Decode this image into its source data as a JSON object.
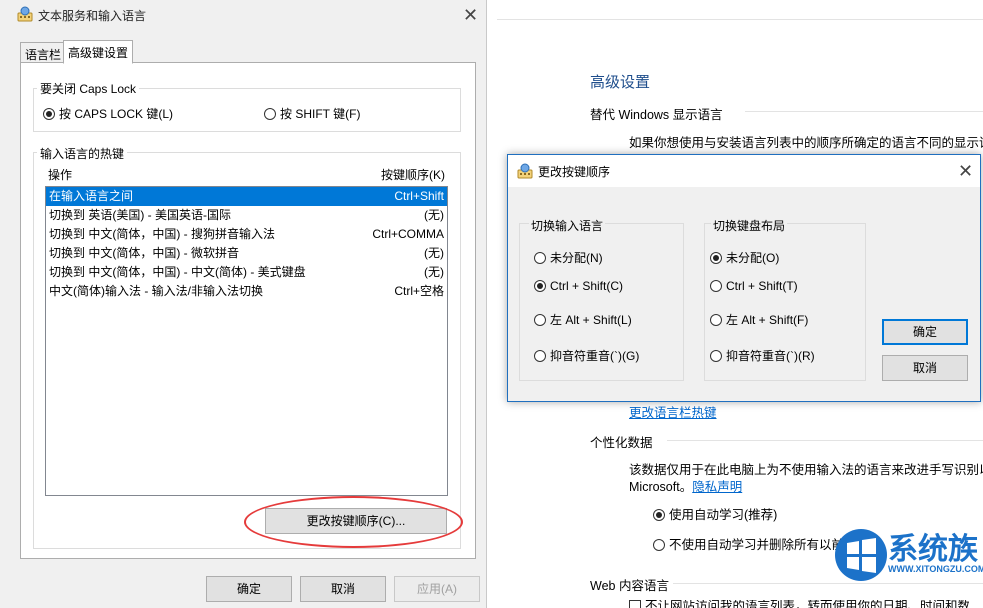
{
  "background": {
    "section_title": "高级设置",
    "override_label": "替代 Windows 显示语言",
    "override_desc": "如果你想使用与安装语言列表中的顺序所确定的语言不同的显示语",
    "langbar_link": "更改语言栏热键",
    "personal_title": "个性化数据",
    "personal_desc1": "该数据仅用于在此电脑上为不使用输入法的语言来改进手写识别以及",
    "personal_desc2_prefix": "Microsoft。",
    "privacy_link": "隐私声明",
    "auto_learn_on": "使用自动学习(推荐)",
    "auto_learn_off": "不使用自动学习并删除所有以前收集的数据",
    "web_title": "Web 内容语言",
    "web_desc": "不让网站访问我的语言列表，转而使用你的日期、时间和数字格"
  },
  "dialog1": {
    "title": "文本服务和输入语言",
    "tabs": [
      "语言栏",
      "高级键设置"
    ],
    "capslock": {
      "legend": "要关闭 Caps Lock",
      "option1": "按 CAPS LOCK 键(L)",
      "option2": "按 SHIFT 键(F)"
    },
    "hotkeys": {
      "legend": "输入语言的热键",
      "col_action": "操作",
      "col_sequence": "按键顺序(K)",
      "rows": [
        {
          "action": "在输入语言之间",
          "key": "Ctrl+Shift"
        },
        {
          "action": "切换到 英语(美国) - 美国英语-国际",
          "key": "(无)"
        },
        {
          "action": "切换到 中文(简体，中国) - 搜狗拼音输入法",
          "key": "Ctrl+COMMA"
        },
        {
          "action": "切换到 中文(简体，中国) - 微软拼音",
          "key": "(无)"
        },
        {
          "action": "切换到 中文(简体，中国) - 中文(简体) - 美式键盘",
          "key": "(无)"
        },
        {
          "action": "中文(简体)输入法 - 输入法/非输入法切换",
          "key": "Ctrl+空格"
        }
      ],
      "change_button": "更改按键顺序(C)..."
    },
    "buttons": {
      "ok": "确定",
      "cancel": "取消",
      "apply": "应用(A)"
    }
  },
  "dialog2": {
    "title": "更改按键顺序",
    "switch_lang": {
      "title": "切换输入语言",
      "options": [
        "未分配(N)",
        "Ctrl + Shift(C)",
        "左 Alt + Shift(L)",
        "抑音符重音(`)(G)"
      ],
      "selected": 1
    },
    "switch_layout": {
      "title": "切换键盘布局",
      "options": [
        "未分配(O)",
        "Ctrl + Shift(T)",
        "左 Alt + Shift(F)",
        "抑音符重音(`)(R)"
      ],
      "selected": 0
    },
    "ok": "确定",
    "cancel": "取消"
  },
  "watermark": {
    "brand": "系统族",
    "url": "WWW.XITONGZU.COM"
  }
}
